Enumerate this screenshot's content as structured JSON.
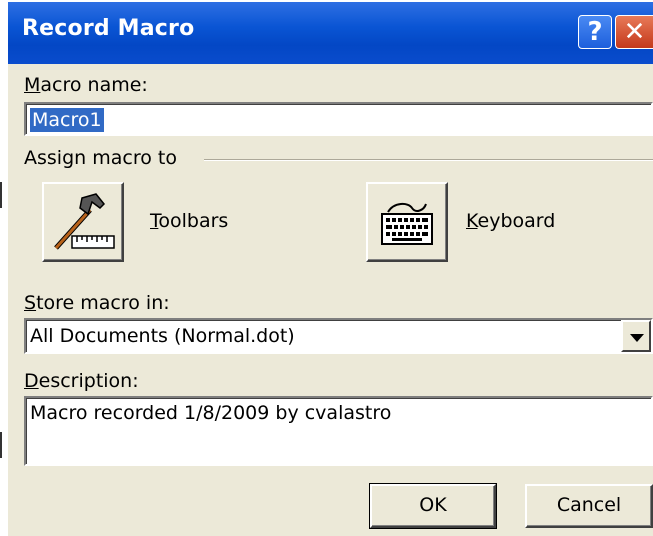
{
  "window": {
    "title": "Record Macro",
    "help_glyph": "?",
    "close_glyph": "✕"
  },
  "macro_name": {
    "label_accel": "M",
    "label_rest": "acro name:",
    "value": "Macro1"
  },
  "assign": {
    "group_label": "Assign macro to",
    "toolbars": {
      "label_accel": "T",
      "label_rest": "oolbars",
      "icon": "hammer-ruler-icon"
    },
    "keyboard": {
      "label_accel": "K",
      "label_rest": "eyboard",
      "icon": "keyboard-icon"
    }
  },
  "store": {
    "label_accel": "S",
    "label_rest": "tore macro in:",
    "value": "All Documents (Normal.dot)"
  },
  "description": {
    "label_accel": "D",
    "label_rest": "escription:",
    "value": "Macro recorded 1/8/2009 by cvalastro"
  },
  "buttons": {
    "ok": "OK",
    "cancel": "Cancel"
  },
  "colors": {
    "titlebar": "#0a55d4",
    "dialog_bg": "#ece9d8",
    "selection": "#316ac5"
  }
}
